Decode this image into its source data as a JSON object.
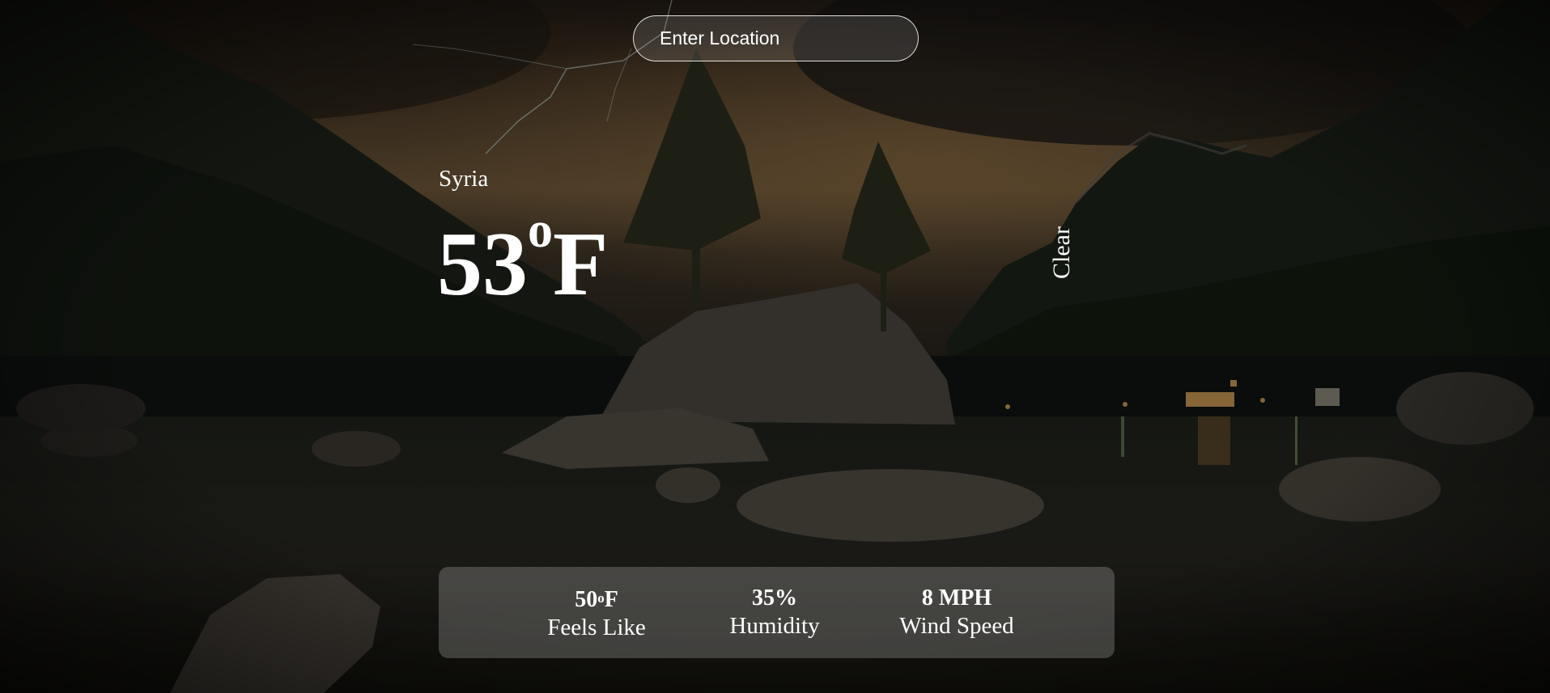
{
  "search": {
    "placeholder": "Enter Location",
    "value": ""
  },
  "weather": {
    "location": "Syria",
    "temperature": "53",
    "temperature_unit": "F",
    "degree_symbol": "o",
    "condition": "Clear"
  },
  "stats": {
    "feels_like": {
      "value": "50",
      "unit": "F",
      "degree_symbol": "o",
      "label": "Feels Like"
    },
    "humidity": {
      "value": "35%",
      "label": "Humidity"
    },
    "wind": {
      "value": "8 MPH",
      "label": "Wind Speed"
    }
  },
  "colors": {
    "text": "#ffffff",
    "panel": "rgba(255,255,255,0.2)",
    "overlay": "#000000"
  }
}
